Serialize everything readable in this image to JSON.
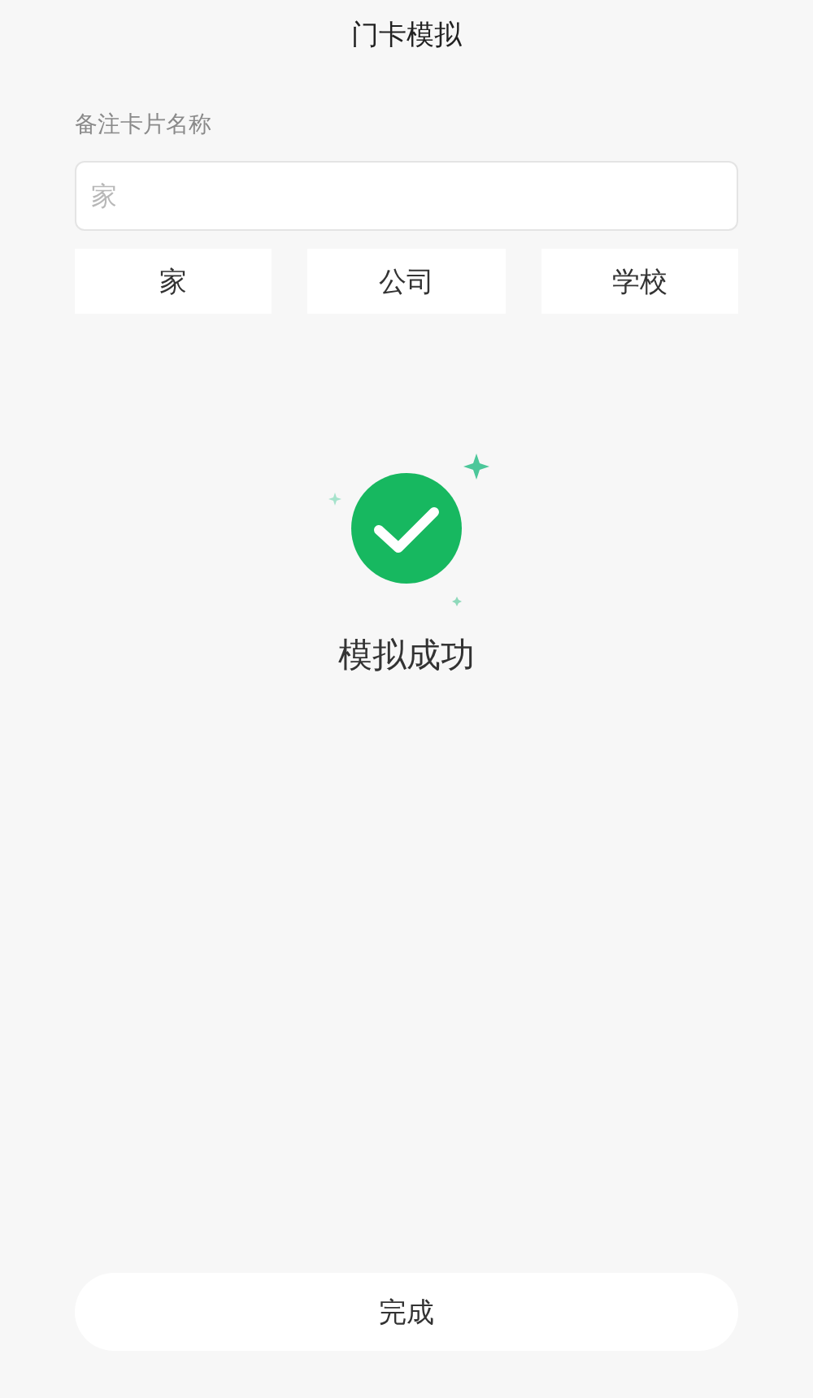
{
  "title": "门卡模拟",
  "card_name": {
    "label": "备注卡片名称",
    "placeholder": "家"
  },
  "presets": [
    "家",
    "公司",
    "学校"
  ],
  "result": {
    "message": "模拟成功"
  },
  "done_button": "完成"
}
